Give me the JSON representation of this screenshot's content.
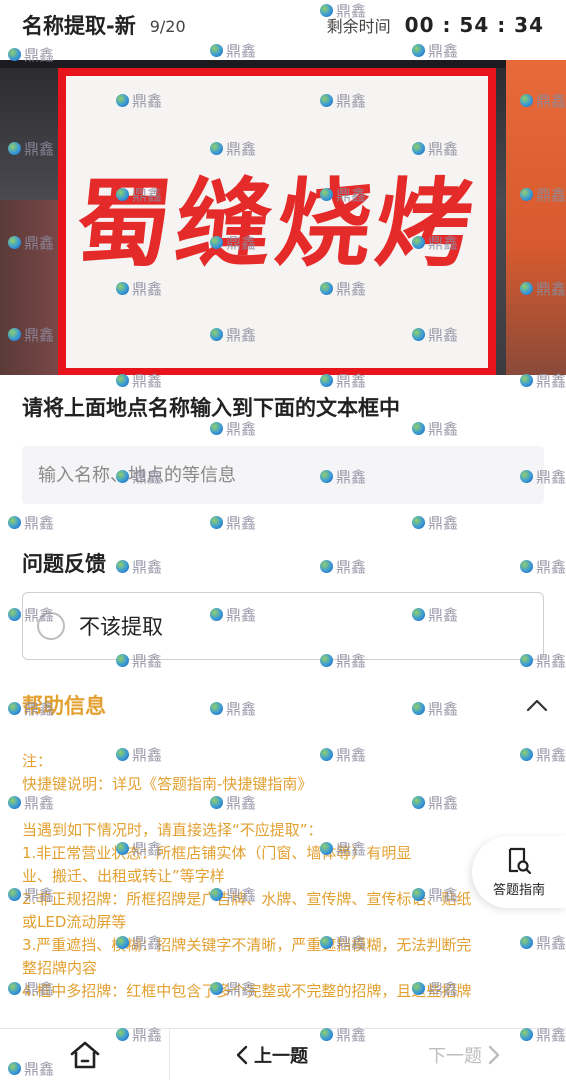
{
  "header": {
    "title": "名称提取-新",
    "progress": "9/20",
    "remain_label": "剩余时间",
    "timer": "00 : 54 : 34"
  },
  "photo": {
    "sign_text": "蜀缝烧烤"
  },
  "instruction": "请将上面地点名称输入到下面的文本框中",
  "name_input": {
    "value": "",
    "placeholder": "输入名称、地点的等信息"
  },
  "feedback": {
    "title": "问题反馈",
    "option_label": "不该提取"
  },
  "help": {
    "title": "帮助信息",
    "lines": [
      "注：",
      "快捷键说明：详见《答题指南-快捷键指南》",
      "",
      "当遇到如下情况时，请直接选择“不应提取”：",
      "1.非正常营业状态：所框店铺实体（门窗、墙体等）有明显",
      "业、搬迁、出租或转让”等字样",
      "2.非正规招牌：所框招牌是广告牌、水牌、宣传牌、宣传标语、贴纸",
      "或LED流动屏等",
      "3.严重遮挡、模糊：招牌关键字不清晰，严重遮挡模糊，无法判断完",
      "整招牌内容",
      "4.框中多招牌：红框中包含了多个完整或不完整的招牌，且这些招牌"
    ]
  },
  "guide_button": {
    "label": "答题指南"
  },
  "bottom_bar": {
    "prev_label": "上一题",
    "next_label": "下一题"
  },
  "watermark": {
    "text": "鼎鑫"
  },
  "colors": {
    "accent_orange": "#e2a030",
    "frame_red": "#e8141c"
  }
}
